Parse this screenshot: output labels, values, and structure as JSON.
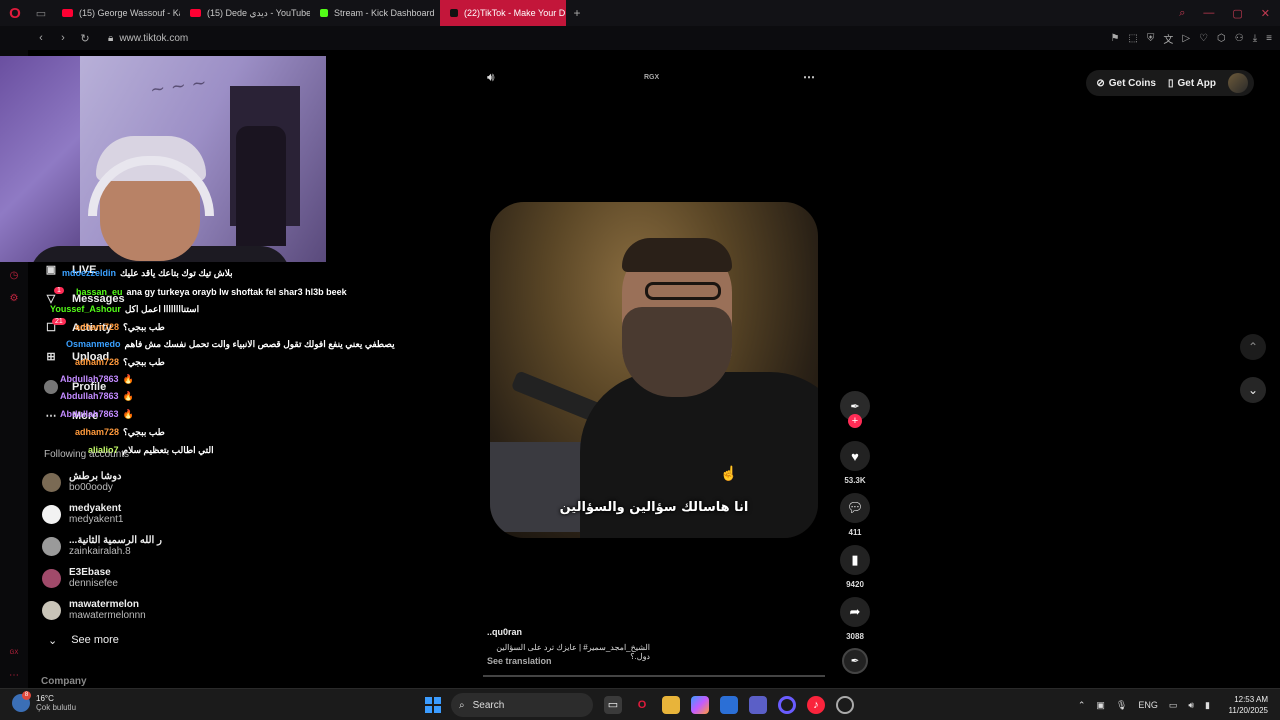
{
  "browser": {
    "tabs": [
      {
        "label": "(15) George Wassouf - Ka",
        "color": "#ff0033"
      },
      {
        "label": "(15) Dede ديدي - YouTube",
        "color": "#ff0033"
      },
      {
        "label": "Stream - Kick Dashboard",
        "color": "#53fc18"
      },
      {
        "label": "(22)TikTok - Make Your D",
        "color": "#111111"
      }
    ],
    "new_tab": "+",
    "url": "www.tiktok.com"
  },
  "sidebar": {
    "live": "LIVE",
    "messages": "Messages",
    "messages_badge": "1",
    "activity_badge": "21",
    "activity": "Activity",
    "upload": "Upload",
    "profile": "Profile",
    "more": "More",
    "following_title": "Following accounts",
    "accounts": [
      {
        "name": "دوشا برطش",
        "user": "bo00oody",
        "color": "#7a6a54"
      },
      {
        "name": "medyakent",
        "user": "medyakent1",
        "color": "#f2f2f2"
      },
      {
        "name": "...ر الله الرسمية الثانية",
        "user": "zainkairalah.8",
        "color": "#9a9a9a"
      },
      {
        "name": "E3Ebase",
        "user": "dennisefee",
        "color": "#a04a6a"
      },
      {
        "name": "mawatermelon",
        "user": "mawatermelonnn",
        "color": "#c9c4b8"
      }
    ],
    "see_more": "See more",
    "company": "Company"
  },
  "chat": [
    {
      "user": "mdoezzeldin",
      "msg": "بلاش تيك توك بتاعك ياقد عليك",
      "color": "#3aa0ff"
    },
    {
      "user": "hassan_eu",
      "msg": "ana gy turkeya orayb lw shoftak fel shar3 hl3b beek",
      "color": "#53fc18"
    },
    {
      "user": "Youssef_Ashour",
      "msg": "استناااااااا اعمل اكل",
      "color": "#53fc18"
    },
    {
      "user": "adham728",
      "msg": "طب ببجي؟",
      "color": "#ff9a3c"
    },
    {
      "user": "Osmanmedo",
      "msg": "يصطفي يعني ينفع افولك تقول قصص الانبياء والت تحمل نفسك مش فاهم",
      "color": "#3aa0ff"
    },
    {
      "user": "adham728",
      "msg": "طب ببجي؟",
      "color": "#ff9a3c"
    },
    {
      "user": "Abdullah7863",
      "msg": "🔥",
      "color": "#c28aff"
    },
    {
      "user": "Abdullah7863",
      "msg": "🔥",
      "color": "#c28aff"
    },
    {
      "user": "Abdullah7863",
      "msg": "🔥",
      "color": "#c28aff"
    },
    {
      "user": "adham728",
      "msg": "طب ببجي؟",
      "color": "#ff9a3c"
    },
    {
      "user": "alialio7",
      "msg": "التي اطالب بتعظيم سلام",
      "color": "#c7ff6a"
    }
  ],
  "player": {
    "brand_tag": "RGX",
    "caption": "انا هاسالك سؤالين والسؤالين",
    "likes": "53.3K",
    "comments": "411",
    "saves": "9420",
    "shares": "3088",
    "author": "..qu0ran",
    "description": "الشيخ_امجد_سمير# | عايزك ترد على السؤالين دول.؟",
    "see_translation": "See translation"
  },
  "header": {
    "get_coins": "Get Coins",
    "get_app": "Get App"
  },
  "taskbar": {
    "temp": "16°C",
    "weather": "Çok bulutlu",
    "weather_badge": "8",
    "search": "Search",
    "lang": "ENG",
    "time": "12:53 AM",
    "date": "11/20/2025"
  }
}
